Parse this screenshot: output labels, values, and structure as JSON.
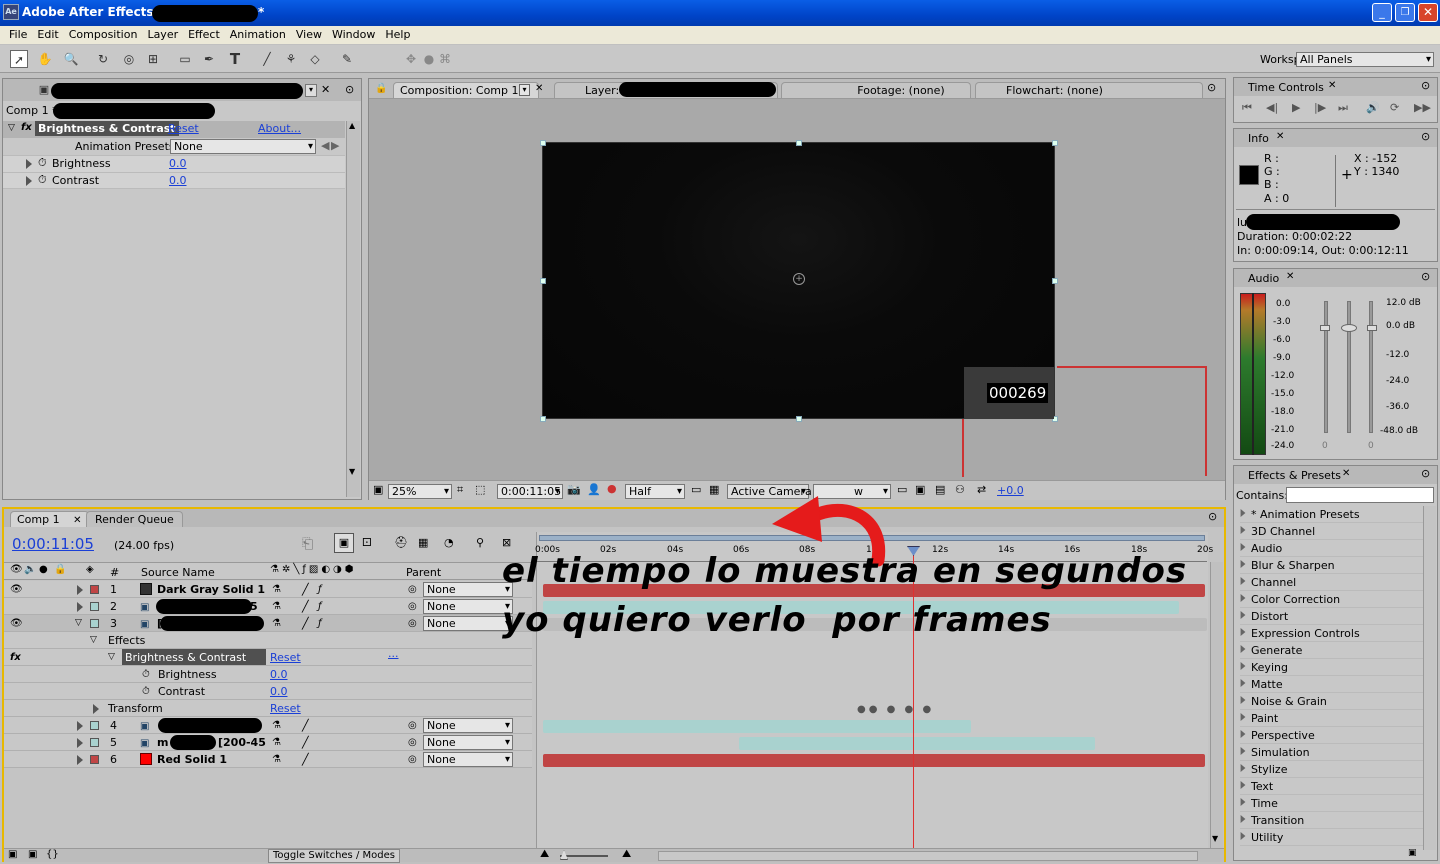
{
  "app": {
    "title_prefix": "Adobe After Effects - ",
    "title_suffix": " *",
    "logo": "Ae"
  },
  "menu": [
    "File",
    "Edit",
    "Composition",
    "Layer",
    "Effect",
    "Animation",
    "View",
    "Window",
    "Help"
  ],
  "workspace": {
    "label": "Workspace:",
    "value": "All Panels"
  },
  "effect_controls": {
    "comp_label": "Comp 1 *",
    "effect_name": "Brightness & Contrast",
    "reset": "Reset",
    "about": "About...",
    "presets_label": "Animation Presets:",
    "presets_value": "None",
    "props": [
      {
        "name": "Brightness",
        "value": "0.0"
      },
      {
        "name": "Contrast",
        "value": "0.0"
      }
    ]
  },
  "viewer": {
    "tabs": [
      "Composition: Comp 1",
      "Layer:",
      "Footage: (none)",
      "Flowchart: (none)"
    ],
    "frame_counter": "000269",
    "zoom": "25%",
    "timecode": "0:00:11:05",
    "resolution": "Half",
    "camera": "Active Camera",
    "exposure": "+0.0",
    "view_fragment": "w"
  },
  "time_controls": {
    "title": "Time Controls"
  },
  "info": {
    "title": "Info",
    "r": "R :",
    "g": "G :",
    "b": "B :",
    "a": "A : 0",
    "x": "X : -152",
    "y": "Y : 1340",
    "name_prefix": "lu",
    "duration": "Duration: 0:00:02:22",
    "in_out": "In: 0:00:09:14, Out: 0:00:12:11"
  },
  "audio": {
    "title": "Audio",
    "levels_left": [
      "0.0",
      "-3.0",
      "-6.0",
      "-9.0",
      "-12.0",
      "-15.0",
      "-18.0",
      "-21.0",
      "-24.0"
    ],
    "levels_right": [
      "12.0 dB",
      "0.0 dB",
      "-12.0",
      "-24.0",
      "-36.0",
      "-48.0 dB"
    ],
    "slider_values": [
      "0",
      "0"
    ]
  },
  "effects_presets": {
    "title": "Effects & Presets",
    "contains_label": "Contains:",
    "items": [
      "* Animation Presets",
      "3D Channel",
      "Audio",
      "Blur & Sharpen",
      "Channel",
      "Color Correction",
      "Distort",
      "Expression Controls",
      "Generate",
      "Keying",
      "Matte",
      "Noise & Grain",
      "Paint",
      "Perspective",
      "Simulation",
      "Stylize",
      "Text",
      "Time",
      "Transition",
      "Utility"
    ]
  },
  "timeline": {
    "tabs": [
      "Comp 1",
      "Render Queue"
    ],
    "timecode": "0:00:11:05",
    "fps": "(24.00 fps)",
    "columns": {
      "num": "#",
      "source": "Source Name",
      "parent": "Parent"
    },
    "ruler": [
      "0:00s",
      "02s",
      "04s",
      "06s",
      "08s",
      "10s",
      "12s",
      "14s",
      "16s",
      "18s",
      "20s"
    ],
    "layers": [
      {
        "num": "1",
        "name": "Dark Gray Solid 1",
        "parent": "None"
      },
      {
        "num": "2",
        "name": "5",
        "parent": "None"
      },
      {
        "num": "3",
        "name": "[",
        "parent": "None"
      },
      {
        "num": "4",
        "name": "",
        "parent": "None"
      },
      {
        "num": "5",
        "name_a": "m",
        "name_b": "[200-45",
        "parent": "None"
      },
      {
        "num": "6",
        "name": "Red Solid 1",
        "parent": "None"
      }
    ],
    "effects_label": "Effects",
    "effect_name": "Brightness & Contrast",
    "reset": "Reset",
    "ellipsis": "...",
    "props": [
      {
        "name": "Brightness",
        "value": "0.0"
      },
      {
        "name": "Contrast",
        "value": "0.0"
      }
    ],
    "transform": "Transform",
    "toggle_label": "Toggle Switches / Modes",
    "colors": {
      "red_bar": "#c04545",
      "teal_bar": "#a9d2cf",
      "playhead": "#e03030",
      "timecode_blue": "#1a3fd6"
    }
  },
  "annotation": {
    "line1": "el tiempo lo muestra en segundos",
    "line2": "yo quiero verlo  por frames",
    "arrow_color": "#e51b1b"
  }
}
